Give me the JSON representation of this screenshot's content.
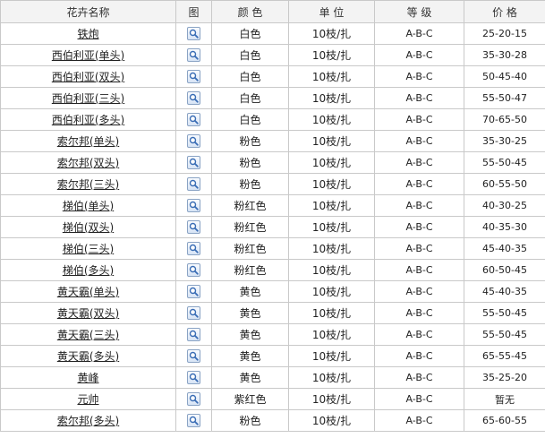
{
  "headers": [
    "花卉名称",
    "图",
    "颜 色",
    "单 位",
    "等 级",
    "价 格"
  ],
  "icon_name": "magnifier-icon",
  "rows": [
    {
      "name": "铁炮",
      "color": "白色",
      "unit": "10枝/扎",
      "grade": "A-B-C",
      "price": "25-20-15"
    },
    {
      "name": "西伯利亚(单头)",
      "color": "白色",
      "unit": "10枝/扎",
      "grade": "A-B-C",
      "price": "35-30-28"
    },
    {
      "name": "西伯利亚(双头)",
      "color": "白色",
      "unit": "10枝/扎",
      "grade": "A-B-C",
      "price": "50-45-40"
    },
    {
      "name": "西伯利亚(三头)",
      "color": "白色",
      "unit": "10枝/扎",
      "grade": "A-B-C",
      "price": "55-50-47"
    },
    {
      "name": "西伯利亚(多头)",
      "color": "白色",
      "unit": "10枝/扎",
      "grade": "A-B-C",
      "price": "70-65-50"
    },
    {
      "name": "索尔邦(单头)",
      "color": "粉色",
      "unit": "10枝/扎",
      "grade": "A-B-C",
      "price": "35-30-25"
    },
    {
      "name": "索尔邦(双头)",
      "color": "粉色",
      "unit": "10枝/扎",
      "grade": "A-B-C",
      "price": "55-50-45"
    },
    {
      "name": "索尔邦(三头)",
      "color": "粉色",
      "unit": "10枝/扎",
      "grade": "A-B-C",
      "price": "60-55-50"
    },
    {
      "name": "梯伯(单头)",
      "color": "粉红色",
      "unit": "10枝/扎",
      "grade": "A-B-C",
      "price": "40-30-25"
    },
    {
      "name": "梯伯(双头)",
      "color": "粉红色",
      "unit": "10枝/扎",
      "grade": "A-B-C",
      "price": "40-35-30"
    },
    {
      "name": "梯伯(三头)",
      "color": "粉红色",
      "unit": "10枝/扎",
      "grade": "A-B-C",
      "price": "45-40-35"
    },
    {
      "name": "梯伯(多头)",
      "color": "粉红色",
      "unit": "10枝/扎",
      "grade": "A-B-C",
      "price": "60-50-45"
    },
    {
      "name": "黄天霸(单头)",
      "color": "黄色",
      "unit": "10枝/扎",
      "grade": "A-B-C",
      "price": "45-40-35"
    },
    {
      "name": "黄天霸(双头)",
      "color": "黄色",
      "unit": "10枝/扎",
      "grade": "A-B-C",
      "price": "55-50-45"
    },
    {
      "name": "黄天霸(三头)",
      "color": "黄色",
      "unit": "10枝/扎",
      "grade": "A-B-C",
      "price": "55-50-45"
    },
    {
      "name": "黄天霸(多头)",
      "color": "黄色",
      "unit": "10枝/扎",
      "grade": "A-B-C",
      "price": "65-55-45"
    },
    {
      "name": "黄峰",
      "color": "黄色",
      "unit": "10枝/扎",
      "grade": "A-B-C",
      "price": "35-25-20"
    },
    {
      "name": "元帅",
      "color": "紫红色",
      "unit": "10枝/扎",
      "grade": "A-B-C",
      "price": "暂无"
    },
    {
      "name": "索尔邦(多头)",
      "color": "粉色",
      "unit": "10枝/扎",
      "grade": "A-B-C",
      "price": "65-60-55"
    }
  ]
}
